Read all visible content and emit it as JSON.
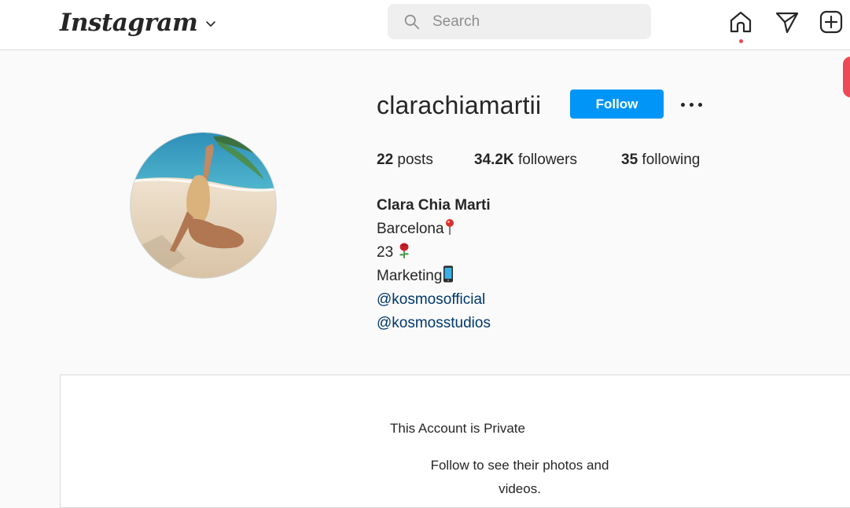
{
  "nav": {
    "logo": "Instagram",
    "search_placeholder": "Search",
    "icons": [
      "home-icon",
      "direct-message-icon",
      "new-post-icon"
    ]
  },
  "profile": {
    "username": "clarachiamartii",
    "follow_label": "Follow",
    "stats": {
      "posts_count": "22",
      "posts_label": "posts",
      "followers_count": "34.2K",
      "followers_label": "followers",
      "following_count": "35",
      "following_label": "following"
    },
    "full_name": "Clara Chia Marti",
    "bio": {
      "line1": "Barcelona",
      "line2": "23",
      "line3": "Marketing",
      "link1": "@kosmosofficial",
      "link2": "@kosmosstudios"
    }
  },
  "private": {
    "title": "This Account is Private",
    "message": "Follow to see their photos and videos."
  },
  "colors": {
    "primary_blue": "#0095f6",
    "link_blue": "#00376b",
    "notification_red": "#ed4956"
  }
}
